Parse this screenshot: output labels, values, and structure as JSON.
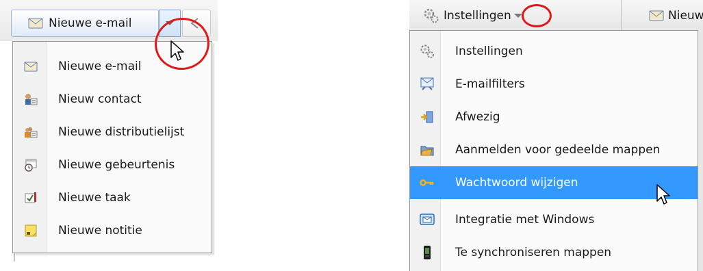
{
  "left": {
    "toolbar_button_label": "Nieuwe e-mail",
    "menu_items": [
      {
        "label": "Nieuwe e-mail",
        "icon": "envelope-icon"
      },
      {
        "label": "Nieuw contact",
        "icon": "contact-card-icon"
      },
      {
        "label": "Nieuwe distributielijst",
        "icon": "distribution-list-icon"
      },
      {
        "label": "Nieuwe gebeurtenis",
        "icon": "calendar-event-icon"
      },
      {
        "label": "Nieuwe taak",
        "icon": "task-icon"
      },
      {
        "label": "Nieuwe notitie",
        "icon": "note-icon"
      }
    ]
  },
  "right": {
    "toolbar_button_label": "Instellingen",
    "toolbar_next_label": "Nieuw",
    "menu_items": [
      {
        "label": "Instellingen",
        "icon": "gear-icon"
      },
      {
        "label": "E-mailfilters",
        "icon": "mail-filter-icon"
      },
      {
        "label": "Afwezig",
        "icon": "out-of-office-icon"
      },
      {
        "label": "Aanmelden voor gedeelde mappen",
        "icon": "shared-folder-icon"
      },
      {
        "label": "Wachtwoord wijzigen",
        "icon": "key-icon",
        "highlighted": true
      },
      {
        "label": "Integratie met Windows",
        "icon": "windows-integration-icon"
      },
      {
        "label": "Te synchroniseren mappen",
        "icon": "phone-sync-icon"
      }
    ]
  },
  "colors": {
    "highlight": "#3399ff",
    "annotation_circle": "#e01818"
  }
}
